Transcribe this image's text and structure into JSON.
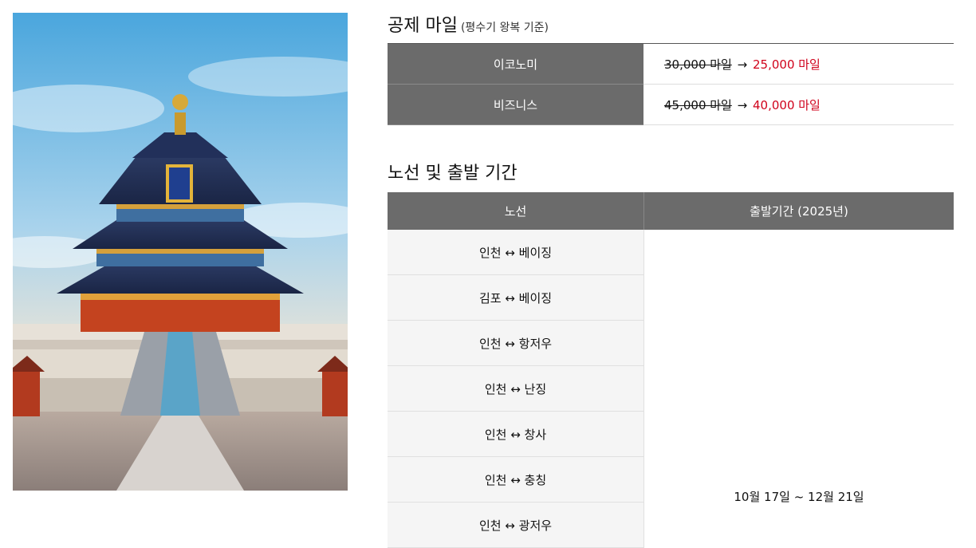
{
  "image": {
    "alt": "베이징 천단 기년전",
    "icon": "temple-photo"
  },
  "miles": {
    "title": "공제 마일",
    "subtitle": "(평수기 왕복 기준)",
    "rows": [
      {
        "class": "이코노미",
        "old": "30,000 마일",
        "arrow": "→",
        "new": "25,000 마일"
      },
      {
        "class": "비즈니스",
        "old": "45,000 마일",
        "arrow": "→",
        "new": "40,000 마일"
      }
    ]
  },
  "routes": {
    "title": "노선 및 출발 기간",
    "headers": {
      "route": "노선",
      "period": "출발기간 (2025년)"
    },
    "items": [
      "인천 ↔ 베이징",
      "김포 ↔ 베이징",
      "인천 ↔ 항저우",
      "인천 ↔ 난징",
      "인천 ↔ 창사",
      "인천 ↔ 충칭",
      "인천 ↔ 광저우"
    ],
    "period": "10월 17일 ~ 12월 21일"
  },
  "colors": {
    "header_bg": "#6b6b6b",
    "accent_red": "#d0021b",
    "row_bg": "#f5f5f5"
  }
}
